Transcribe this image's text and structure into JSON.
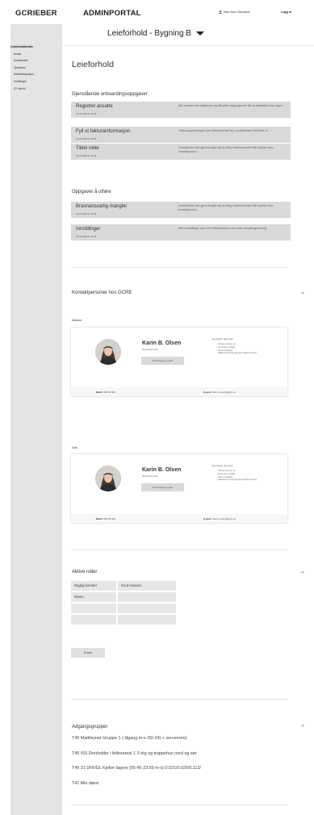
{
  "header": {
    "logo": "GCRIEBER",
    "portal": "ADMINPORTAL",
    "user_name": "Navn Navn Navnesen",
    "logout_label": "Logg ut"
  },
  "sidebar": {
    "items": [
      {
        "label": "Leieforholdforside",
        "active": true
      },
      {
        "label": "Ansatt",
        "active": false
      },
      {
        "label": "Kontaktroller",
        "active": false
      },
      {
        "label": "Gjestekort",
        "active": false
      },
      {
        "label": "Nøkkelkortpakker",
        "active": false
      },
      {
        "label": "Innstillinger",
        "active": false
      },
      {
        "label": "IZY admin",
        "active": false
      }
    ]
  },
  "main": {
    "selector_label": "Leieforhold - Bygning B",
    "title": "Leieforhold",
    "onboarding": {
      "title": "Gjenstående onboardingsoppgaver",
      "tasks": [
        {
          "title": "Registrer ansatte",
          "date": "22.02.2023 kl. 14:04",
          "description": "Alle ansatte må registreres og tilknyttes adgangsoner slik at nøkkelkort kan lages."
        },
        {
          "title": "Fyll ut fakturainformasjon",
          "date": "22.02.2023 kl. 14:04",
          "description": "Fakturaopplysninger som fakturaformat og e-postadresse må fylles ut."
        },
        {
          "title": "Tildel roller",
          "date": "22.02.2023 kl. 14:04",
          "description": "Kontaktroller bør gjennomgås slik at riktig vedkommende står oppført som kontaktperson."
        }
      ]
    },
    "todo": {
      "title": "Oppgaver å utføre",
      "tasks": [
        {
          "title": "Brannansvarlig mangler",
          "date": "22.02.2023 kl. 14:04",
          "description": "Kontaktroller bør gjennomgås slik at riktig vedkommende står oppført som kontaktperson."
        },
        {
          "title": "Innstillinger",
          "date": "22.02.2023 kl. 14:04",
          "description": "Sett innstillinger som vil forhåndsutfylles ved neste ansattregistrering."
        }
      ]
    },
    "contacts": {
      "title": "Kontaktpersoner hos GCRE",
      "cards": [
        {
          "label": "Marked",
          "name": "Karin B. Olsen",
          "role": "Markedskontakt",
          "button": "Send meg en e-post",
          "help_title": "Jeg hjelper deg med:",
          "help_items": [
            "Tema nummer en",
            "Et annet område",
            "Flere områder",
            "Masseris av ting jeg kan hjelpe til med"
          ],
          "mobile_label": "Mobil:",
          "mobile": "999 99 999",
          "email_label": "E-post:",
          "email": "Karin.b.olsen@gcre.no"
        },
        {
          "label": "Drift",
          "name": "Karin B. Olsen",
          "role": "Markedskontakt",
          "button": "Send meg en e-post",
          "help_title": "Jeg hjelper deg med:",
          "help_items": [
            "Tema nummer en",
            "Et annet område",
            "Flere områder",
            "Masseris av ting jeg kan hjelpe til med"
          ],
          "mobile_label": "Mobil:",
          "mobile": "999 99 999",
          "email_label": "E-post:",
          "email": "Karin.b.olsen@gcre.no"
        }
      ]
    },
    "roles": {
      "title": "Aktive roller",
      "rows": [
        [
          "Daglig kontakt",
          "Knut Hansen"
        ],
        [
          "Brann",
          ""
        ],
        [
          "",
          ""
        ],
        [
          "",
          ""
        ]
      ],
      "edit_label": "Endre"
    },
    "access_groups": {
      "title": "Adgangsgrupper",
      "items": [
        "T49 Mattilsynet Gruppe 1 ( tilgang m-s /00-24) + serverrom)",
        "T49 ISS Renholder i fellesareal 1 3 etg og trappehus nord og sør",
        "T49 31 DNVGL Kjeller lagere (05:45-23:59 m-s) 0.021/0.025/0.113/",
        "T41 Alle dører"
      ]
    }
  },
  "colors": {
    "sidebar_bg": "#e4e4e4",
    "task_bg": "#d9d9d9",
    "text": "#333333"
  }
}
